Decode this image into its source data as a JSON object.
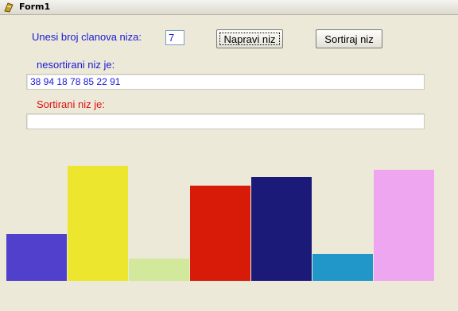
{
  "window": {
    "title": "Form1"
  },
  "form": {
    "count_label": "Unesi broj clanova niza:",
    "count_value": "7",
    "make_button": "Napravi niz",
    "sort_button": "Sortiraj niz",
    "unsorted_label": "nesortirani niz je:",
    "unsorted_value": "38 94 18 78 85 22 91",
    "sorted_label": "Sortirani niz je:",
    "sorted_value": ""
  },
  "colors": {
    "label_blue": "#1a1ad6",
    "label_red": "#e01010"
  },
  "chart_data": {
    "type": "bar",
    "values": [
      38,
      94,
      18,
      78,
      85,
      22,
      91
    ],
    "colors": [
      "#5040cc",
      "#ece62e",
      "#d2e89a",
      "#d81a08",
      "#1c1a78",
      "#2196c8",
      "#eea6f0"
    ],
    "ylim": [
      0,
      100
    ]
  }
}
